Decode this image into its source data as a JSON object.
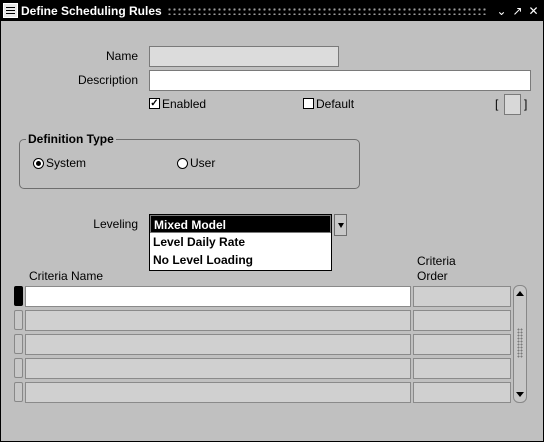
{
  "window": {
    "title": "Define Scheduling Rules",
    "buttons": {
      "minimize": "⌄",
      "maximize": "↗",
      "close": "✕"
    }
  },
  "form": {
    "name_label": "Name",
    "name_value": "",
    "description_label": "Description",
    "description_value": "",
    "enabled_label": "Enabled",
    "enabled_checked": true,
    "default_label": "Default",
    "default_checked": false,
    "dff_bracket_open": "[",
    "dff_bracket_close": "]"
  },
  "definition_type": {
    "title": "Definition Type",
    "options": [
      {
        "label": "System",
        "selected": true
      },
      {
        "label": "User",
        "selected": false
      }
    ]
  },
  "leveling": {
    "label": "Leveling",
    "options": [
      "Mixed Model",
      "Level Daily Rate",
      "No Level Loading"
    ],
    "selected_index": 0
  },
  "criteria_table": {
    "headers": {
      "name": "Criteria Name",
      "order_line1": "Criteria",
      "order_line2": "Order"
    },
    "rows": [
      {
        "name": "",
        "order": ""
      },
      {
        "name": "",
        "order": ""
      },
      {
        "name": "",
        "order": ""
      },
      {
        "name": "",
        "order": ""
      },
      {
        "name": "",
        "order": ""
      }
    ]
  }
}
